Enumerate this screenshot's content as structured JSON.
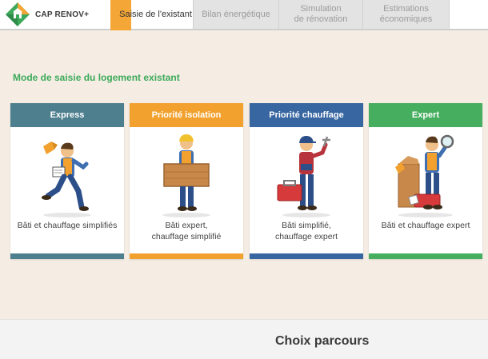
{
  "app": {
    "name": "CAP RENOV+"
  },
  "tabs": [
    {
      "label": "Saisie de l'existant"
    },
    {
      "label": "Bilan énergétique"
    },
    {
      "label": "Simulation\nde rénovation"
    },
    {
      "label": "Estimations\néconomiques"
    }
  ],
  "section_title": "Mode de saisie du logement existant",
  "cards": [
    {
      "title": "Express",
      "description": "Bâti et chauffage simplifiés",
      "color": "#4e7f8f"
    },
    {
      "title": "Priorité isolation",
      "description": "Bâti expert,\nchauffage simplifié",
      "color": "#f2a12e"
    },
    {
      "title": "Priorité chauffage",
      "description": "Bâti simplifié,\nchauffage expert",
      "color": "#3766a0"
    },
    {
      "title": "Expert",
      "description": "Bâti et chauffage expert",
      "color": "#45ae5f"
    }
  ],
  "footer_title": "Choix parcours",
  "colors": {
    "accent": "#f4a636",
    "green": "#3daa5a",
    "background": "#f5ede4"
  }
}
